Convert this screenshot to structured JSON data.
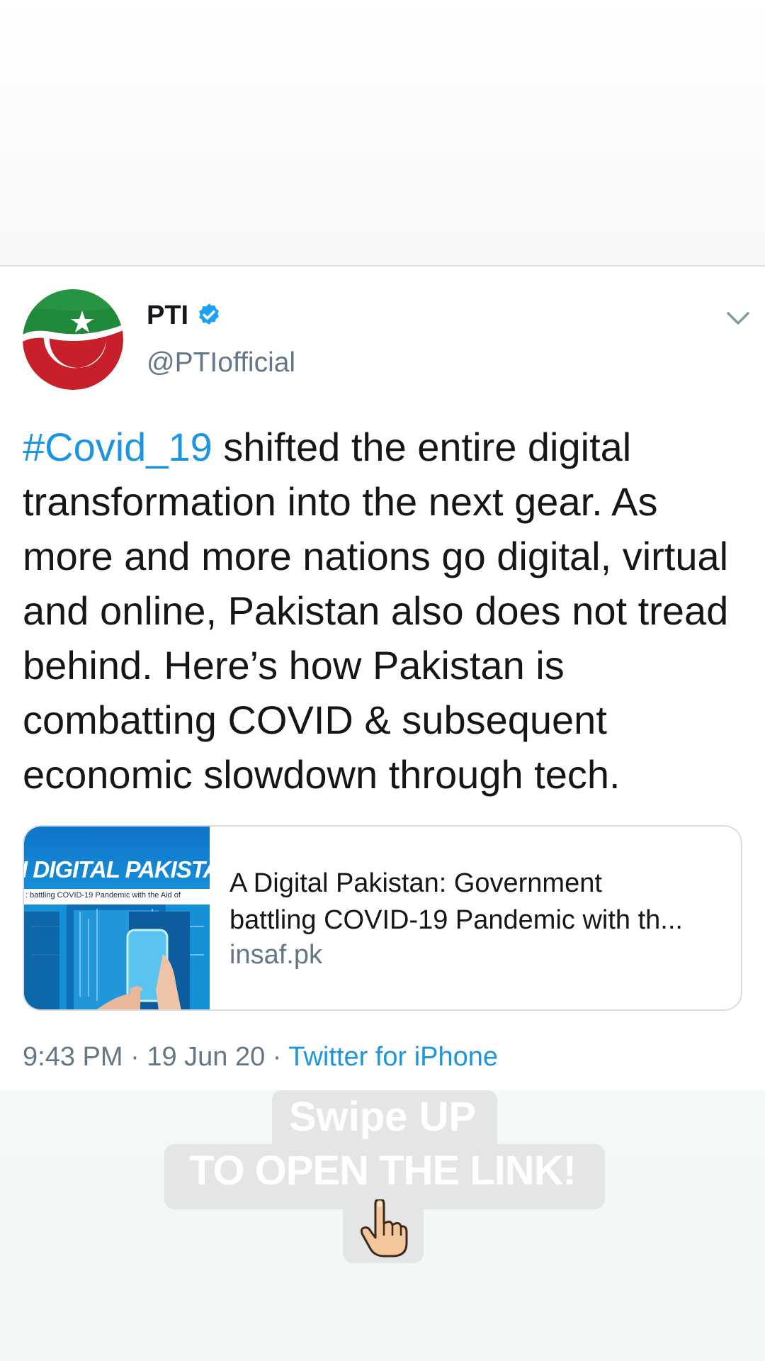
{
  "tweet": {
    "author": {
      "display_name": "PTI",
      "handle": "@PTIofficial",
      "verified": true
    },
    "text": {
      "hashtag": "#Covid_19",
      "body": " shifted the entire digital transformation into the next gear. As more and more nations go digital, virtual and online, Pakistan also does not tread behind. Here’s how Pakistan is combatting COVID & subsequent economic slowdown through tech."
    },
    "link_card": {
      "thumbnail_title": "I DIGITAL PAKISTAN",
      "thumbnail_subtitle": ": battling COVID-19 Pandemic with the Aid of",
      "title_line1": "A Digital Pakistan: Government",
      "title_line2": "battling COVID-19 Pandemic with th...",
      "domain": "insaf.pk"
    },
    "meta": {
      "time": "9:43 PM",
      "separator1": " · ",
      "date": "19 Jun 20",
      "separator2": " · ",
      "source": "Twitter for iPhone"
    }
  },
  "overlay": {
    "line1": "Swipe UP",
    "line2": "TO OPEN THE LINK!",
    "emoji": "pointing-hand-icon"
  },
  "colors": {
    "link_blue": "#1b95e0",
    "text_primary": "#14171a",
    "text_secondary": "#657786",
    "verified_blue": "#1da1f2"
  }
}
